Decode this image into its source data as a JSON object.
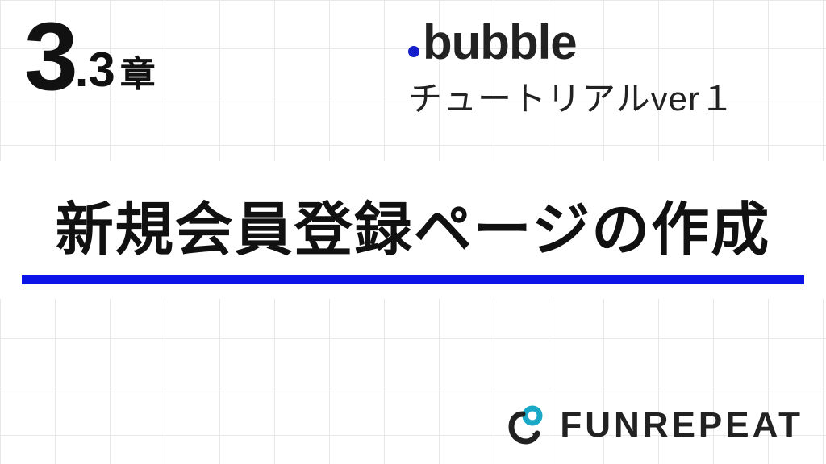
{
  "chapter": {
    "number_major": "3",
    "separator": ".",
    "number_minor": "3",
    "label": "章"
  },
  "brand": {
    "logo_text": "bubble",
    "subtitle": "チュートリアルver１"
  },
  "title": {
    "text": "新規会員登録ページの作成"
  },
  "footer": {
    "brand_text": "FUNREPEAT"
  },
  "colors": {
    "accent_blue": "#0a14e6",
    "bubble_dot": "#1520cc",
    "footer_icon_accent": "#1aa8c7"
  }
}
